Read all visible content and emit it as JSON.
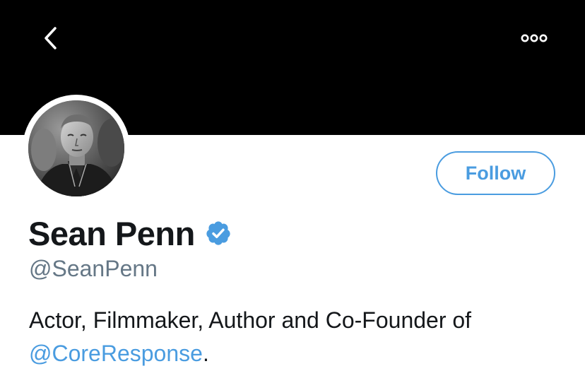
{
  "header": {
    "back_icon": "chevron-left-icon",
    "more_icon": "more-horizontal-icon",
    "banner_color": "#000000"
  },
  "profile": {
    "display_name": "Sean Penn",
    "verified": true,
    "verified_icon": "verified-badge-icon",
    "handle": "@SeanPenn",
    "follow_label": "Follow",
    "bio_text": "Actor, Filmmaker, Author and Co-Founder of",
    "bio_mention": "@CoreResponse",
    "bio_suffix": "."
  },
  "colors": {
    "accent": "#4a9ce0",
    "text_primary": "#14171a",
    "text_secondary": "#657786"
  }
}
